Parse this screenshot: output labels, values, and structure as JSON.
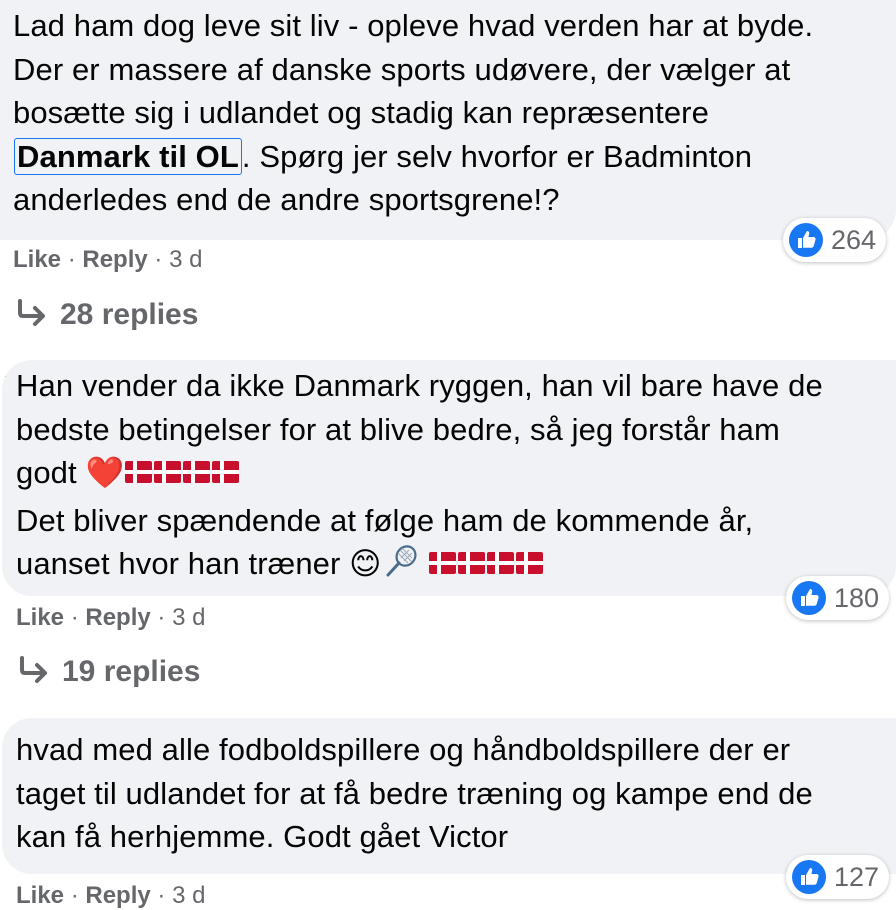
{
  "comments": [
    {
      "text_before": "Lad ham dog leve sit liv - opleve hvad verden har at byde. Der er massere af danske sports udøvere, der vælger at bosætte sig i udlandet og stadig kan repræsentere ",
      "mention": "Danmark til OL",
      "text_after": ". Spørg jer selv hvorfor er Badminton anderledes end de andre sportsgrene!?",
      "likes": "264",
      "actions": {
        "like": "Like",
        "reply": "Reply",
        "sep": "·",
        "time": "3 d"
      },
      "replies": "28 replies"
    },
    {
      "line1": "Han vender da ikke Danmark ryggen, han vil bare have de bedste betingelser for at blive bedre, så jeg forstår ham godt ",
      "heart": "❤️",
      "line2": "Det bliver spændende at følge ham de kommende år, uanset hvor han træner ",
      "smile": "😊",
      "likes": "180",
      "actions": {
        "like": "Like",
        "reply": "Reply",
        "sep": "·",
        "time": "3 d"
      },
      "replies": "19 replies"
    },
    {
      "text": "hvad med alle fodboldspillere og håndboldspillere der er taget til udlandet for at få bedre træning og kampe end de kan få herhjemme. Godt gået Victor",
      "likes": "127",
      "actions": {
        "like": "Like",
        "reply": "Reply",
        "sep": "·",
        "time": "3 d"
      }
    }
  ],
  "colors": {
    "bubble": "#f0f2f5",
    "text": "#050505",
    "secondary": "#65676b",
    "like_blue": "#1877f2",
    "flag_red": "#c8102e"
  },
  "icons": {
    "like": "thumbs-up-icon",
    "reply_arrow": "reply-arrow-icon",
    "flag": "denmark-flag-icon",
    "racket": "badminton-racket-icon"
  }
}
